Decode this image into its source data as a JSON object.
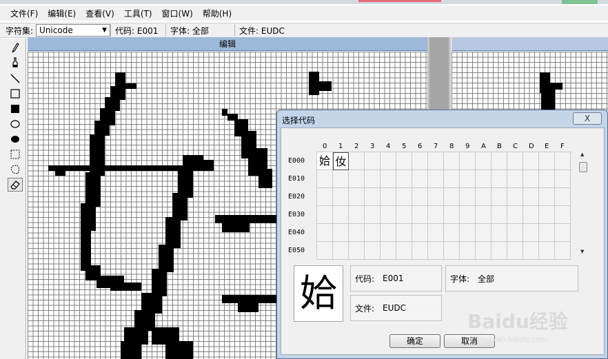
{
  "menu": [
    "文件(F)",
    "编辑(E)",
    "查看(V)",
    "工具(T)",
    "窗口(W)",
    "帮助(H)"
  ],
  "infobar": {
    "charset_label": "字符集:",
    "charset_value": "Unicode",
    "code": "代码: E001",
    "font": "字体: 全部",
    "file": "文件: EUDC"
  },
  "tools": [
    "pencil-icon",
    "brush-icon",
    "line-icon",
    "hollow-rectangle-icon",
    "filled-rectangle-icon",
    "hollow-ellipse-icon",
    "filled-ellipse-icon",
    "rect-select-icon",
    "freeform-select-icon",
    "eraser-icon"
  ],
  "edit_panel": {
    "title": "编辑"
  },
  "dialog": {
    "title": "选择代码",
    "close": "X",
    "hex_columns": [
      "0",
      "1",
      "2",
      "3",
      "4",
      "5",
      "6",
      "7",
      "8",
      "9",
      "A",
      "B",
      "C",
      "D",
      "E",
      "F"
    ],
    "row_labels": [
      "E000",
      "E010",
      "E020",
      "E030",
      "E040",
      "E050"
    ],
    "filled_chars": [
      "姶",
      "㚢"
    ],
    "preview_char": "姶",
    "code_label": "代码:",
    "code_value": "E001",
    "font_label": "字体:",
    "font_value": "全部",
    "file_label": "文件:",
    "file_value": "EUDC",
    "ok_label": "确定",
    "cancel_label": "取消"
  },
  "watermark": {
    "logo": "Baidu经验",
    "url": "jingyan.baidu.com"
  }
}
